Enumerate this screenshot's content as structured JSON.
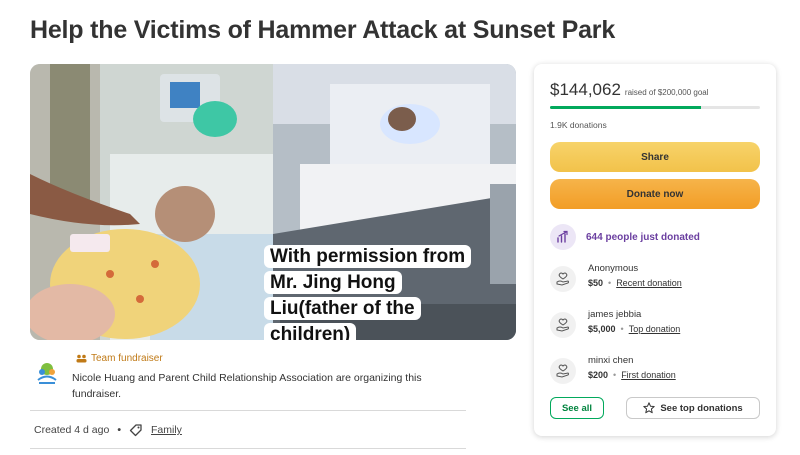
{
  "page": {
    "title": "Help the Victims of Hammer Attack at Sunset Park"
  },
  "hero": {
    "overlay_lines": [
      "With permission from",
      "Mr. Jing Hong",
      "Liu(father of the",
      "children)"
    ]
  },
  "organizer": {
    "team_label": "Team fundraiser",
    "text": "Nicole Huang and Parent Child Relationship Association are organizing this fundraiser.",
    "created": "Created 4 d ago",
    "category": "Family"
  },
  "donation_panel": {
    "raised": "$144,062",
    "goal_text": "raised of $200,000 goal",
    "progress_fraction": 0.72,
    "donations_count": "1.9K donations",
    "share_label": "Share",
    "donate_label": "Donate now",
    "trending_text": "644 people just donated",
    "donors": [
      {
        "name": "Anonymous",
        "amount": "$50",
        "tag": "Recent donation"
      },
      {
        "name": "james jebbia",
        "amount": "$5,000",
        "tag": "Top donation"
      },
      {
        "name": "minxi chen",
        "amount": "$200",
        "tag": "First donation"
      }
    ],
    "see_all_label": "See all",
    "see_top_label": "See top donations"
  },
  "colors": {
    "brand_green": "#02a95c",
    "share_yellow": "#f2c24a",
    "donate_orange": "#f29d26",
    "trending_purple": "#6b3fa0"
  }
}
